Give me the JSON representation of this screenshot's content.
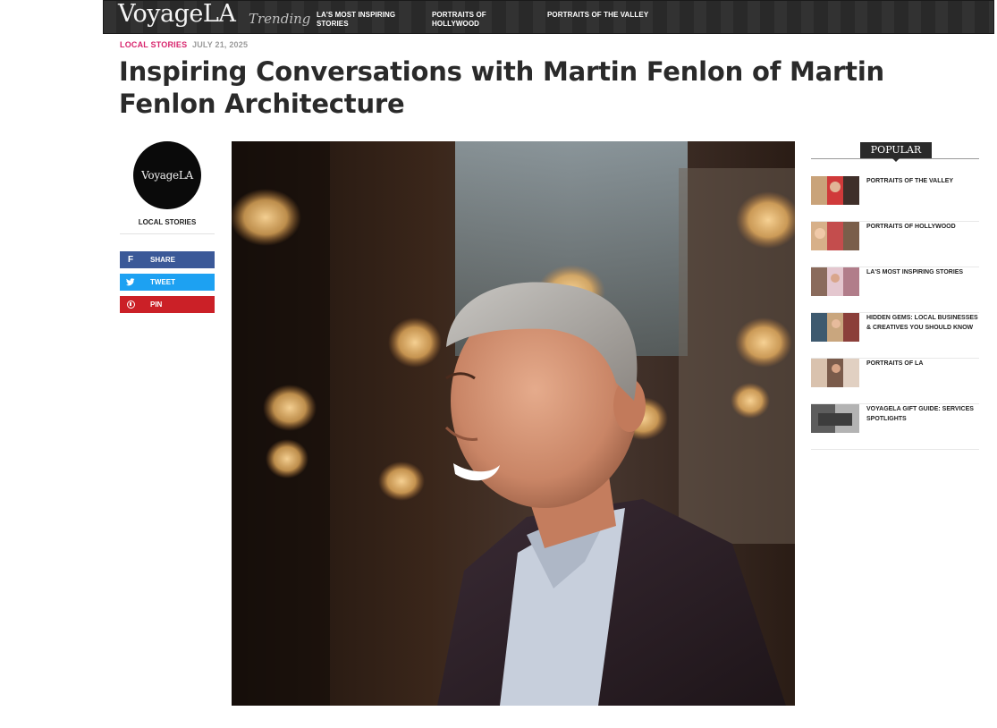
{
  "header": {
    "logo": "VoyageLA",
    "trending_label": "Trending",
    "nav": [
      {
        "label": "LA'S MOST INSPIRING STORIES"
      },
      {
        "label": "PORTRAITS OF HOLLYWOOD"
      },
      {
        "label": "PORTRAITS OF THE VALLEY"
      }
    ]
  },
  "article": {
    "category": "LOCAL STORIES",
    "date": "JULY 21, 2025",
    "title": "Inspiring Conversations with Martin Fenlon of Martin Fenlon Architecture"
  },
  "author": {
    "avatar_text": "VoyageLA",
    "label": "LOCAL STORIES"
  },
  "share": {
    "facebook": "SHARE",
    "twitter": "TWEET",
    "pinterest": "PIN"
  },
  "sidebar": {
    "heading": "POPULAR",
    "items": [
      {
        "label": "PORTRAITS OF THE VALLEY"
      },
      {
        "label": "PORTRAITS OF HOLLYWOOD"
      },
      {
        "label": "LA'S MOST INSPIRING STORIES"
      },
      {
        "label": "HIDDEN GEMS: LOCAL BUSINESSES & CREATIVES YOU SHOULD KNOW"
      },
      {
        "label": "PORTRAITS OF LA"
      },
      {
        "label": "VOYAGELA GIFT GUIDE: SERVICES SPOTLIGHTS"
      }
    ]
  },
  "colors": {
    "category": "#d8266e",
    "facebook": "#3b5998",
    "twitter": "#1da1f2",
    "pinterest": "#cb2027",
    "topbar": "#2b2b2b"
  },
  "icons": [
    "facebook-icon",
    "twitter-icon",
    "pinterest-icon"
  ]
}
